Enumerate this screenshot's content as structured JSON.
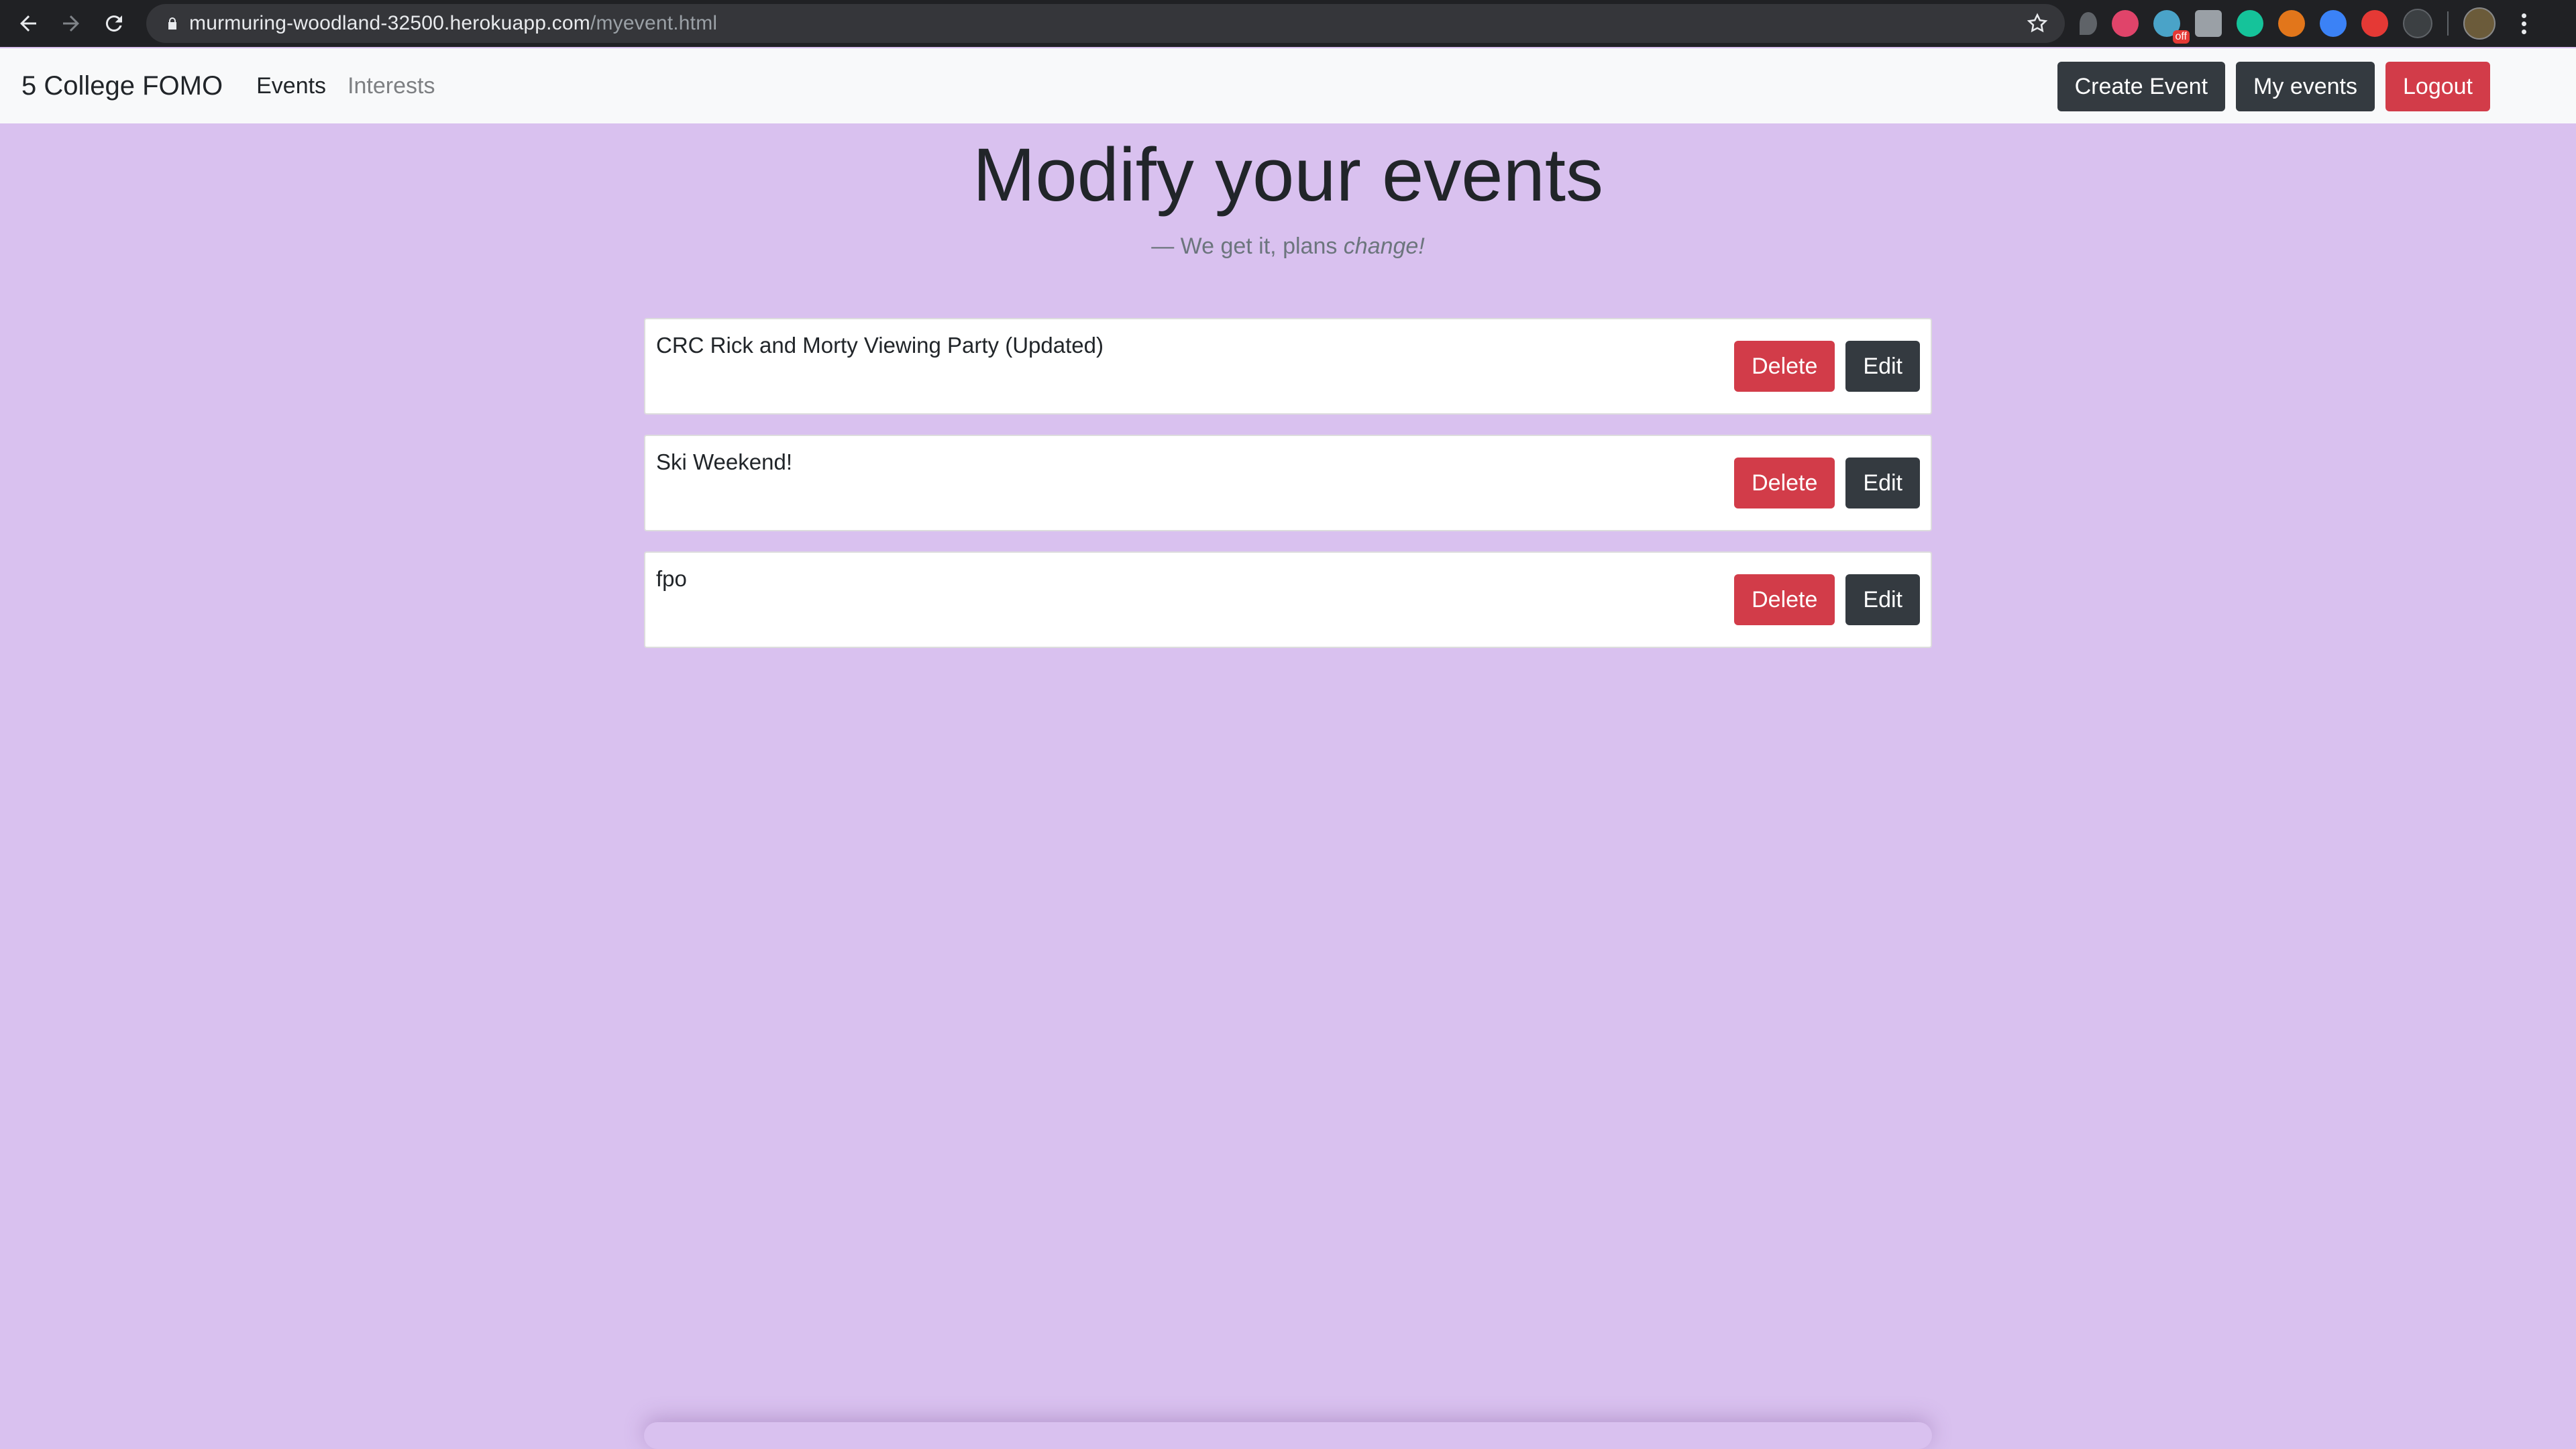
{
  "browser": {
    "url_host": "murmuring-woodland-32500.herokuapp.com",
    "url_path": "/myevent.html",
    "ext_badge": "off"
  },
  "navbar": {
    "brand": "5 College FOMO",
    "links": [
      "Events",
      "Interests"
    ],
    "create_event": "Create Event",
    "my_events": "My events",
    "logout": "Logout"
  },
  "main": {
    "title": "Modify your events",
    "subtitle_prefix": "— We get it, plans ",
    "subtitle_emph": "change!"
  },
  "events": [
    {
      "title": "CRC Rick and Morty Viewing Party (Updated)",
      "delete": "Delete",
      "edit": "Edit"
    },
    {
      "title": "Ski Weekend!",
      "delete": "Delete",
      "edit": "Edit"
    },
    {
      "title": "fpo",
      "delete": "Delete",
      "edit": "Edit"
    }
  ],
  "colors": {
    "page_bg": "#d9c1ef",
    "dark_btn": "#343a40",
    "danger_btn": "#d23c49"
  }
}
